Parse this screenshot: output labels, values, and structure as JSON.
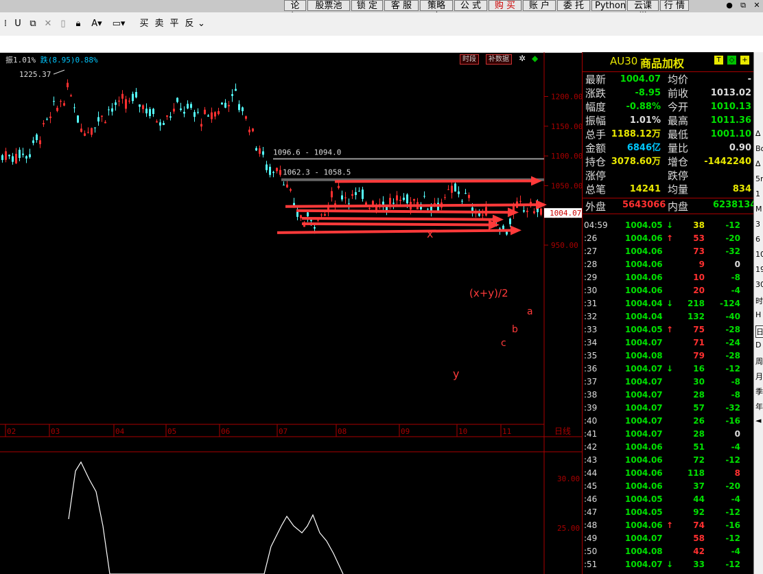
{
  "menu": [
    "论 坛",
    "股票池",
    "锁 定",
    "客 服",
    "策略库",
    "公 式",
    "购 买",
    "账 户",
    "委 托",
    "Python",
    "云课堂",
    "行 情"
  ],
  "toolbar": {
    "buy": "买",
    "sell": "卖",
    "flat": "平",
    "reverse": "反"
  },
  "chart": {
    "title_amp": "振1.01%",
    "title_change": "跌(8.95)0.88%",
    "btn_period": "时段",
    "btn_data": "补数据",
    "high_label": "1225.37",
    "price_axis": [
      "1200.00",
      "1150.00",
      "1100.00",
      "1050.00",
      "1000.00",
      "950.00"
    ],
    "current_price": "1004.07",
    "level1": "1096.6 - 1094.0",
    "level2": "1062.3 - 1058.5",
    "ann_x": "x",
    "ann_y": "y",
    "ann_mid": "(x+y)/2",
    "ann_a": "a",
    "ann_b": "b",
    "ann_c": "c",
    "date_axis": [
      "02",
      "03",
      "04",
      "05",
      "06",
      "07",
      "08",
      "09",
      "10",
      "11"
    ],
    "period": "日线",
    "ind_axis": [
      "30.00",
      "25.00"
    ]
  },
  "panel": {
    "symbol": "AU30",
    "name": "商品加权",
    "quote": [
      {
        "l1": "最新",
        "v1": "1004.07",
        "c1": "#00e000",
        "l2": "均价",
        "v2": "-",
        "c2": "#ddd"
      },
      {
        "l1": "涨跌",
        "v1": "-8.95",
        "c1": "#00e000",
        "l2": "前收",
        "v2": "1013.02",
        "c2": "#ddd"
      },
      {
        "l1": "幅度",
        "v1": "-0.88%",
        "c1": "#00e000",
        "l2": "今开",
        "v2": "1010.13",
        "c2": "#00e000"
      },
      {
        "l1": "振幅",
        "v1": "1.01%",
        "c1": "#ddd",
        "l2": "最高",
        "v2": "1011.36",
        "c2": "#00e000"
      },
      {
        "l1": "总手",
        "v1": "1188.12万",
        "c1": "#e8e800",
        "l2": "最低",
        "v2": "1001.10",
        "c2": "#00e000"
      },
      {
        "l1": "金额",
        "v1": "6846亿",
        "c1": "#00c8ff",
        "l2": "量比",
        "v2": "0.90",
        "c2": "#ddd"
      },
      {
        "l1": "持仓",
        "v1": "3078.60万",
        "c1": "#e8e800",
        "l2": "增仓",
        "v2": "-1442240",
        "c2": "#e8e800"
      },
      {
        "l1": "涨停",
        "v1": "",
        "c1": "#ddd",
        "l2": "跌停",
        "v2": "",
        "c2": "#ddd"
      },
      {
        "l1": "总笔",
        "v1": "14241",
        "c1": "#e8e800",
        "l2": "均量",
        "v2": "834",
        "c2": "#e8e800"
      }
    ],
    "outer_label": "外盘",
    "outer_value": "5643066",
    "inner_label": "内盘",
    "inner_value": "6238134",
    "ticks": [
      {
        "t": "04:59",
        "p": "1004.05",
        "a": "↓",
        "ac": "#00e000",
        "v": "38",
        "vc": "#e8e800",
        "d": "-12",
        "dc": "#00e000"
      },
      {
        "t": ":26",
        "p": "1004.06",
        "a": "↑",
        "ac": "#ff3030",
        "v": "53",
        "vc": "#ff3030",
        "d": "-20",
        "dc": "#00e000"
      },
      {
        "t": ":27",
        "p": "1004.06",
        "a": "",
        "ac": "#ddd",
        "v": "73",
        "vc": "#ff3030",
        "d": "-32",
        "dc": "#00e000"
      },
      {
        "t": ":28",
        "p": "1004.06",
        "a": "",
        "ac": "#ddd",
        "v": "9",
        "vc": "#ff3030",
        "d": "0",
        "dc": "#ddd"
      },
      {
        "t": ":29",
        "p": "1004.06",
        "a": "",
        "ac": "#ddd",
        "v": "10",
        "vc": "#ff3030",
        "d": "-8",
        "dc": "#00e000"
      },
      {
        "t": ":30",
        "p": "1004.06",
        "a": "",
        "ac": "#ddd",
        "v": "20",
        "vc": "#ff3030",
        "d": "-4",
        "dc": "#00e000"
      },
      {
        "t": ":31",
        "p": "1004.04",
        "a": "↓",
        "ac": "#00e000",
        "v": "218",
        "vc": "#00e000",
        "d": "-124",
        "dc": "#00e000"
      },
      {
        "t": ":32",
        "p": "1004.04",
        "a": "",
        "ac": "#ddd",
        "v": "132",
        "vc": "#00e000",
        "d": "-40",
        "dc": "#00e000"
      },
      {
        "t": ":33",
        "p": "1004.05",
        "a": "↑",
        "ac": "#ff3030",
        "v": "75",
        "vc": "#ff3030",
        "d": "-28",
        "dc": "#00e000"
      },
      {
        "t": ":34",
        "p": "1004.07",
        "a": "",
        "ac": "#ddd",
        "v": "71",
        "vc": "#ff3030",
        "d": "-24",
        "dc": "#00e000"
      },
      {
        "t": ":35",
        "p": "1004.08",
        "a": "",
        "ac": "#ddd",
        "v": "79",
        "vc": "#ff3030",
        "d": "-28",
        "dc": "#00e000"
      },
      {
        "t": ":36",
        "p": "1004.07",
        "a": "↓",
        "ac": "#00e000",
        "v": "16",
        "vc": "#00e000",
        "d": "-12",
        "dc": "#00e000"
      },
      {
        "t": ":37",
        "p": "1004.07",
        "a": "",
        "ac": "#ddd",
        "v": "30",
        "vc": "#00e000",
        "d": "-8",
        "dc": "#00e000"
      },
      {
        "t": ":38",
        "p": "1004.07",
        "a": "",
        "ac": "#ddd",
        "v": "28",
        "vc": "#00e000",
        "d": "-8",
        "dc": "#00e000"
      },
      {
        "t": ":39",
        "p": "1004.07",
        "a": "",
        "ac": "#ddd",
        "v": "57",
        "vc": "#00e000",
        "d": "-32",
        "dc": "#00e000"
      },
      {
        "t": ":40",
        "p": "1004.07",
        "a": "",
        "ac": "#ddd",
        "v": "26",
        "vc": "#00e000",
        "d": "-16",
        "dc": "#00e000"
      },
      {
        "t": ":41",
        "p": "1004.07",
        "a": "",
        "ac": "#ddd",
        "v": "28",
        "vc": "#00e000",
        "d": "0",
        "dc": "#ddd"
      },
      {
        "t": ":42",
        "p": "1004.06",
        "a": "",
        "ac": "#ddd",
        "v": "51",
        "vc": "#00e000",
        "d": "-4",
        "dc": "#00e000"
      },
      {
        "t": ":43",
        "p": "1004.06",
        "a": "",
        "ac": "#ddd",
        "v": "72",
        "vc": "#00e000",
        "d": "-12",
        "dc": "#00e000"
      },
      {
        "t": ":44",
        "p": "1004.06",
        "a": "",
        "ac": "#ddd",
        "v": "118",
        "vc": "#00e000",
        "d": "8",
        "dc": "#ff3030"
      },
      {
        "t": ":45",
        "p": "1004.06",
        "a": "",
        "ac": "#ddd",
        "v": "37",
        "vc": "#00e000",
        "d": "-20",
        "dc": "#00e000"
      },
      {
        "t": ":46",
        "p": "1004.05",
        "a": "",
        "ac": "#ddd",
        "v": "44",
        "vc": "#00e000",
        "d": "-4",
        "dc": "#00e000"
      },
      {
        "t": ":47",
        "p": "1004.05",
        "a": "",
        "ac": "#ddd",
        "v": "92",
        "vc": "#00e000",
        "d": "-12",
        "dc": "#00e000"
      },
      {
        "t": ":48",
        "p": "1004.06",
        "a": "↑",
        "ac": "#ff3030",
        "v": "74",
        "vc": "#ff3030",
        "d": "-16",
        "dc": "#00e000"
      },
      {
        "t": ":49",
        "p": "1004.07",
        "a": "",
        "ac": "#ddd",
        "v": "58",
        "vc": "#ff3030",
        "d": "-12",
        "dc": "#00e000"
      },
      {
        "t": ":50",
        "p": "1004.08",
        "a": "",
        "ac": "#ddd",
        "v": "42",
        "vc": "#ff3030",
        "d": "-4",
        "dc": "#00e000"
      },
      {
        "t": ":51",
        "p": "1004.07",
        "a": "↓",
        "ac": "#00e000",
        "v": "33",
        "vc": "#00e000",
        "d": "-12",
        "dc": "#00e000"
      }
    ]
  },
  "sidebar_right": [
    "∆",
    "Bo",
    "∆",
    "5r",
    "1",
    "M",
    "3",
    "6",
    "10",
    "19",
    "30",
    "时",
    "H",
    "日",
    "D",
    "周",
    "月",
    "季",
    "年",
    "◄"
  ]
}
